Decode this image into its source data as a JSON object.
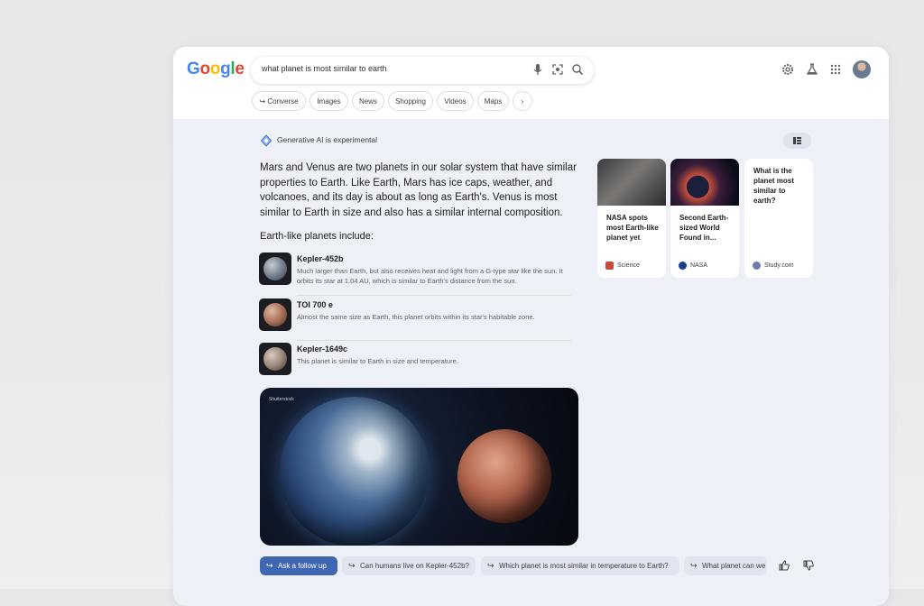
{
  "header": {
    "logo": [
      "G",
      "o",
      "o",
      "g",
      "l",
      "e"
    ],
    "logo_colors": [
      "#4285F4",
      "#EA4335",
      "#FBBC05",
      "#4285F4",
      "#34A853",
      "#EA4335"
    ],
    "search": {
      "query": "what planet is most similar to earth"
    },
    "icons": [
      "mic-icon",
      "lens-icon",
      "search-icon",
      "gear-icon",
      "labs-icon",
      "apps-icon",
      "avatar"
    ]
  },
  "chips": [
    {
      "label": "Converse",
      "icon": "converse-icon"
    },
    {
      "label": "Images"
    },
    {
      "label": "News"
    },
    {
      "label": "Shopping"
    },
    {
      "label": "Videos"
    },
    {
      "label": "Maps"
    }
  ],
  "ai": {
    "label": "Generative AI is experimental",
    "summary": "Mars and Venus are two planets in our solar system that have similar properties to Earth. Like Earth, Mars has ice caps, weather, and volcanoes, and its day is about as long as Earth's. Venus is most similar to Earth in size and also has a similar internal composition.",
    "subhead": "Earth-like planets include:",
    "items": [
      {
        "title": "Kepler-452b",
        "desc": "Much larger than Earth, but also receives heat and light from a G-type star like the sun. It orbits its star at 1.04 AU, which is similar to Earth's distance from the sun."
      },
      {
        "title": "TOI 700 e",
        "desc": "Almost the same size as Earth, this planet orbits within its star's habitable zone."
      },
      {
        "title": "Kepler-1649c",
        "desc": "This planet is similar to Earth in size and temperature."
      }
    ],
    "image_credit": "Shutterstock"
  },
  "cards": [
    {
      "title": "NASA spots most Earth-like planet yet",
      "source": "Science"
    },
    {
      "title": "Second Earth-sized World Found in...",
      "source": "NASA"
    },
    {
      "title": "What is the planet most similar to earth?",
      "source": "Study.com"
    }
  ],
  "followups": [
    {
      "label": "Ask a follow up"
    },
    {
      "label": "Can humans live on Kepler-452b?"
    },
    {
      "label": "Which planet is most similar in temperature to Earth?"
    },
    {
      "label": "What planet can we"
    }
  ]
}
